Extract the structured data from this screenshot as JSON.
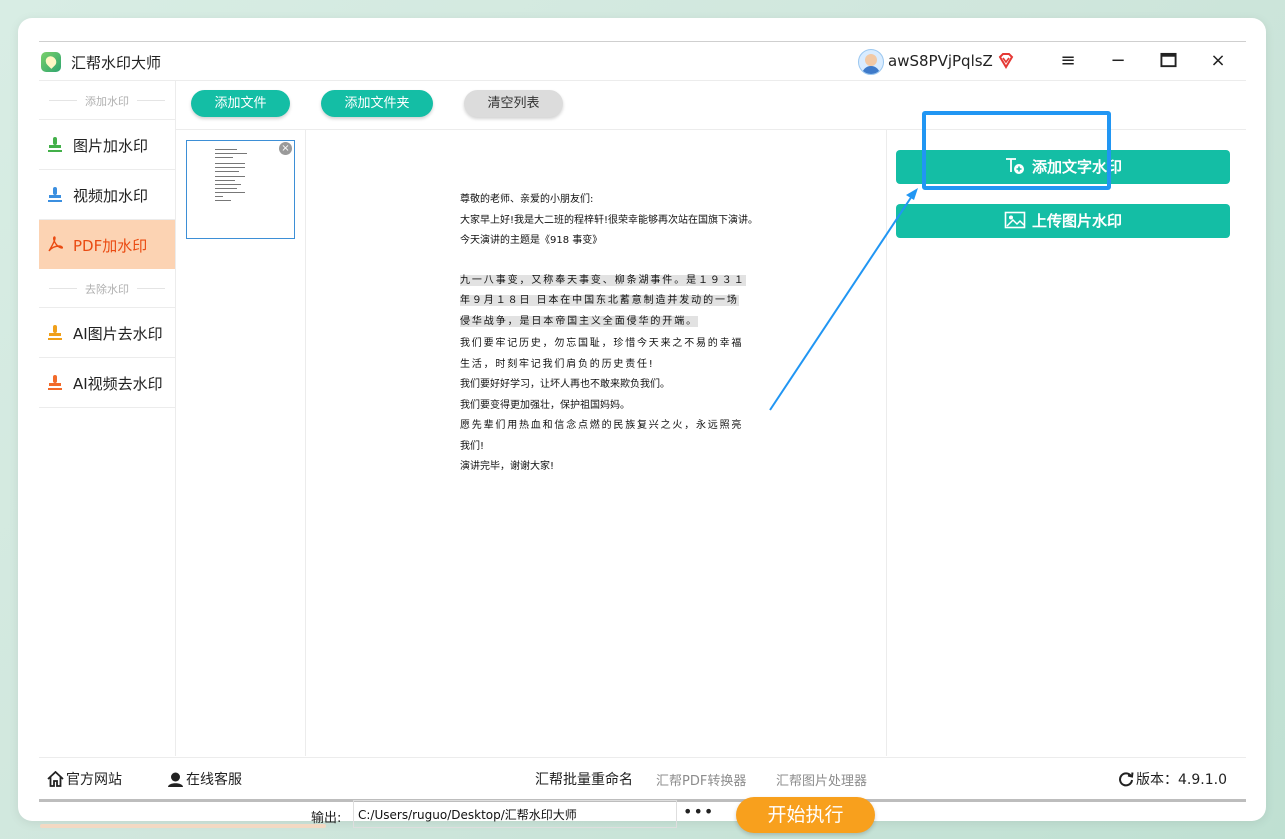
{
  "app": {
    "title": "汇帮水印大师",
    "username": "awS8PVjPqlsZ"
  },
  "sidebar": {
    "section_add": "添加水印",
    "section_remove": "去除水印",
    "items": [
      {
        "label": "图片加水印"
      },
      {
        "label": "视频加水印"
      },
      {
        "label": "PDF加水印"
      },
      {
        "label": "AI图片去水印"
      },
      {
        "label": "AI视频去水印"
      }
    ],
    "colors": {
      "active_bg": "#fcd3b3",
      "active_text": "#ea4b12"
    }
  },
  "toolbar": {
    "add_file": "添加文件",
    "add_folder": "添加文件夹",
    "clear_list": "清空列表"
  },
  "preview": {
    "lines": [
      "尊敬的老师、亲爱的小朋友们:",
      "大家早上好!我是大二班的程梓轩!很荣幸能够再次站在国旗下演讲。",
      "今天演讲的主题是《918 事变》",
      "九一八事变，又称奉天事变、柳条湖事件。是１９３１",
      "年９月１８日 日本在中国东北蓄意制造并发动的一场",
      "侵华战争，是日本帝国主义全面侵华的开端。",
      "我们要牢记历史，勿忘国耻，珍惜今天来之不易的幸福",
      "生活，时刻牢记我们肩负的历史责任!",
      "我们要好好学习，让坏人再也不敢来欺负我们。",
      "我们要变得更加强壮，保护祖国妈妈。",
      "愿先辈们用热血和信念点燃的民族复兴之火，永远照亮",
      "我们!",
      "演讲完毕，谢谢大家!"
    ]
  },
  "output": {
    "label": "输出:",
    "path": "C:/Users/ruguo/Desktop/汇帮水印大师",
    "more": "•••"
  },
  "start_button": "开始执行",
  "right_panel": {
    "add_text_watermark": "添加文字水印",
    "upload_image_watermark": "上传图片水印"
  },
  "footer": {
    "official_site": "官方网站",
    "online_service": "在线客服",
    "links": [
      "汇帮批量重命名",
      "汇帮PDF转换器",
      "汇帮图片处理器"
    ],
    "version_label": "版本：",
    "version": "4.9.1.0"
  },
  "icons": {
    "thumb_close": "×",
    "menu": "≡",
    "minimize": "−",
    "maximize": "☐",
    "close": "×"
  },
  "colors": {
    "accent": "#14bea5",
    "start": "#f8a01d",
    "highlight_box": "#2196f3"
  }
}
